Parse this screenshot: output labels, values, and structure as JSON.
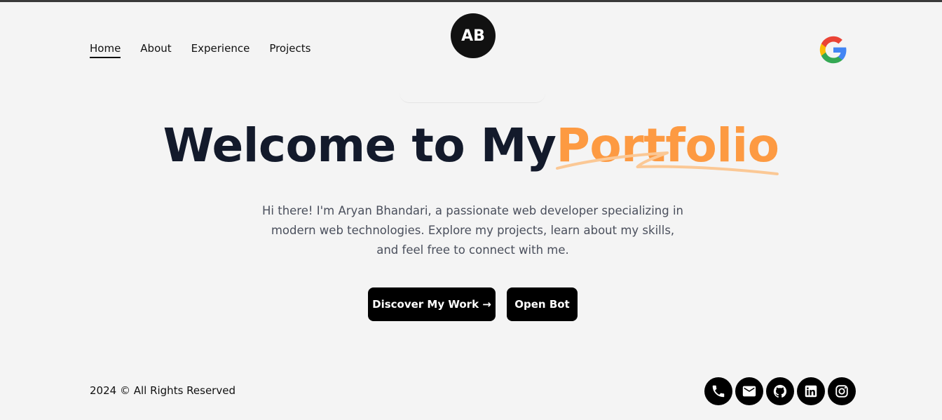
{
  "nav": {
    "items": [
      {
        "label": "Home",
        "active": true
      },
      {
        "label": "About"
      },
      {
        "label": "Experience"
      },
      {
        "label": "Projects"
      }
    ]
  },
  "logo": {
    "initials": "AB"
  },
  "header": {
    "google_icon": "google-g-icon"
  },
  "hero": {
    "title_main": "Welcome to My",
    "title_accent": "Portfolio",
    "accent_color": "#fd9a42",
    "description": "Hi there! I'm Aryan Bhandari, a passionate web developer specializing in modern web technologies. Explore my projects, learn about my skills, and feel free to connect with me."
  },
  "buttons": {
    "discover": "Discover My Work →",
    "bot": "Open Bot"
  },
  "footer": {
    "copyright": "2024 © All Rights Reserved",
    "socials": [
      "phone-icon",
      "mail-icon",
      "github-icon",
      "linkedin-icon",
      "instagram-icon"
    ]
  }
}
